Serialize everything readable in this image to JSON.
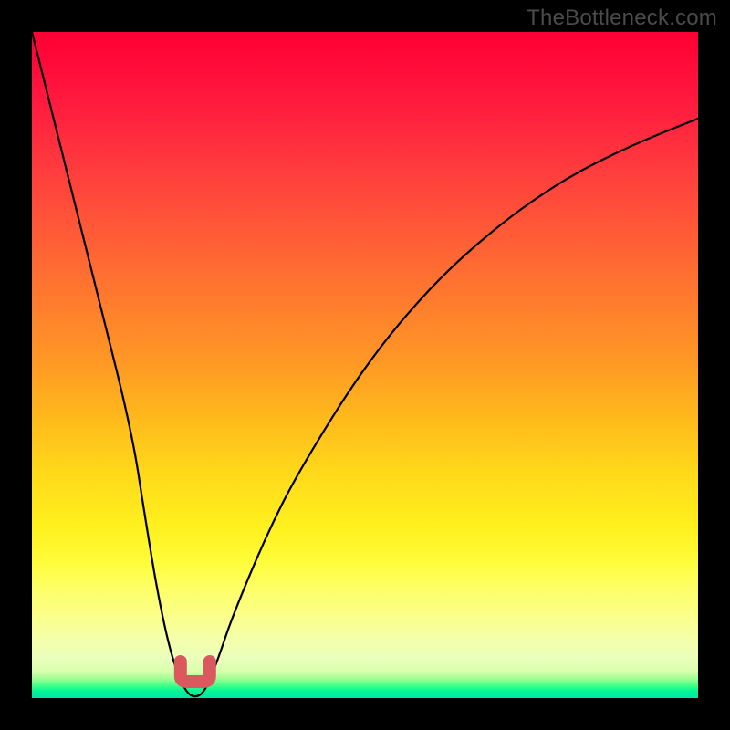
{
  "watermark": "TheBottleneck.com",
  "colors": {
    "background": "#000000",
    "watermark": "#4b4b4b",
    "curve_stroke": "#000000",
    "trough_marker": "#d9595f",
    "gradient_top": "#ff0033",
    "gradient_mid_orange": "#ff9a24",
    "gradient_yellow": "#fff01e",
    "gradient_green": "#00e4a5"
  },
  "chart_data": {
    "type": "line",
    "title": "",
    "xlabel": "",
    "ylabel": "",
    "x": [
      0,
      5,
      10,
      15,
      17,
      19,
      21,
      23,
      24.5,
      26,
      28,
      30,
      35,
      40,
      50,
      60,
      70,
      80,
      90,
      100
    ],
    "y_bottleneck_pct": [
      100,
      80,
      60,
      40,
      27,
      15,
      6,
      1,
      0,
      1,
      6,
      12,
      24,
      34,
      50,
      62,
      71,
      78,
      83,
      87
    ],
    "xlim": [
      0,
      100
    ],
    "ylim": [
      0,
      100
    ],
    "trough": {
      "x": 24.5,
      "y": 0
    },
    "gradient_stops_pct_from_top": {
      "red": 0,
      "orange": 50,
      "yellow": 80,
      "pale": 92,
      "green": 100
    },
    "notes": "V-shaped bottleneck curve over a vertical red-to-green gradient; trough highlighted with a small pink U marker near x≈24.5."
  }
}
